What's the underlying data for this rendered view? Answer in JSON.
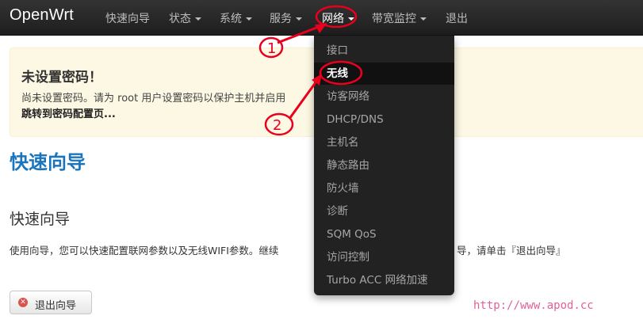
{
  "navbar": {
    "brand": "OpenWrt",
    "items": [
      {
        "label": "快速向导",
        "has_caret": false
      },
      {
        "label": "状态",
        "has_caret": true
      },
      {
        "label": "系统",
        "has_caret": true
      },
      {
        "label": "服务",
        "has_caret": true
      },
      {
        "label": "网络",
        "has_caret": true,
        "active": true
      },
      {
        "label": "带宽监控",
        "has_caret": true
      },
      {
        "label": "退出",
        "has_caret": false
      }
    ]
  },
  "alert": {
    "title": "未设置密码！",
    "text": "尚未设置密码。请为 root 用户设置密码以保护主机并启用",
    "link": "跳转到密码配置页..."
  },
  "page": {
    "title": "快速向导",
    "section_title": "快速向导",
    "description": "使用向导，您可以快速配置联网参数以及无线WIFI参数。继续",
    "description_tail": "导，请单击『退出向导』",
    "exit_button": "退出向导"
  },
  "dropdown": {
    "items": [
      "接口",
      "无线",
      "访客网络",
      "DHCP/DNS",
      "主机名",
      "静态路由",
      "防火墙",
      "诊断",
      "SQM QoS",
      "访问控制",
      "Turbo ACC 网络加速"
    ],
    "selected": "无线"
  },
  "annotations": {
    "marker_1": "1",
    "marker_2": "2",
    "color": "#e8001c"
  },
  "watermark": "http://www.apod.cc",
  "colors": {
    "navbar_bg": "#222222",
    "alert_bg": "#fcf8e3",
    "title_blue": "#1b75bc",
    "watermark": "#e0609a"
  }
}
